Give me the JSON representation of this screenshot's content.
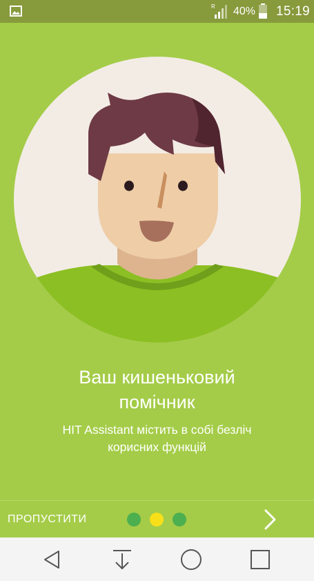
{
  "status_bar": {
    "icons": {
      "notification": "gallery-icon",
      "signal": "cell-signal-icon",
      "roaming_marker": "R",
      "battery": "battery-icon"
    },
    "battery_percent": "40%",
    "battery_level": 0.4,
    "time": "15:19"
  },
  "onboarding": {
    "title_lines": [
      "Ваш кишеньковий",
      "помічник"
    ],
    "subtitle_lines": [
      "HIT Assistant містить в собі безліч",
      "корисних функцій"
    ],
    "illustration": "assistant-avatar-illustration",
    "skip_label": "ПРОПУСТИТИ",
    "pagination": {
      "total": 3,
      "current_page": 2,
      "active_color": "#f7e019",
      "inactive_color": "#4caf50"
    },
    "next_icon": "chevron-right-icon"
  },
  "nav_bar": {
    "buttons": [
      "back-icon",
      "notifications-pull-icon",
      "home-icon",
      "recents-icon"
    ]
  },
  "colors": {
    "background": "#a4cc48",
    "status_bar": "#879a3c",
    "avatar_circle": "#f3ece5",
    "shirt": "#8cbf23",
    "hair": "#6d3a45",
    "skin": "#eecda7"
  }
}
